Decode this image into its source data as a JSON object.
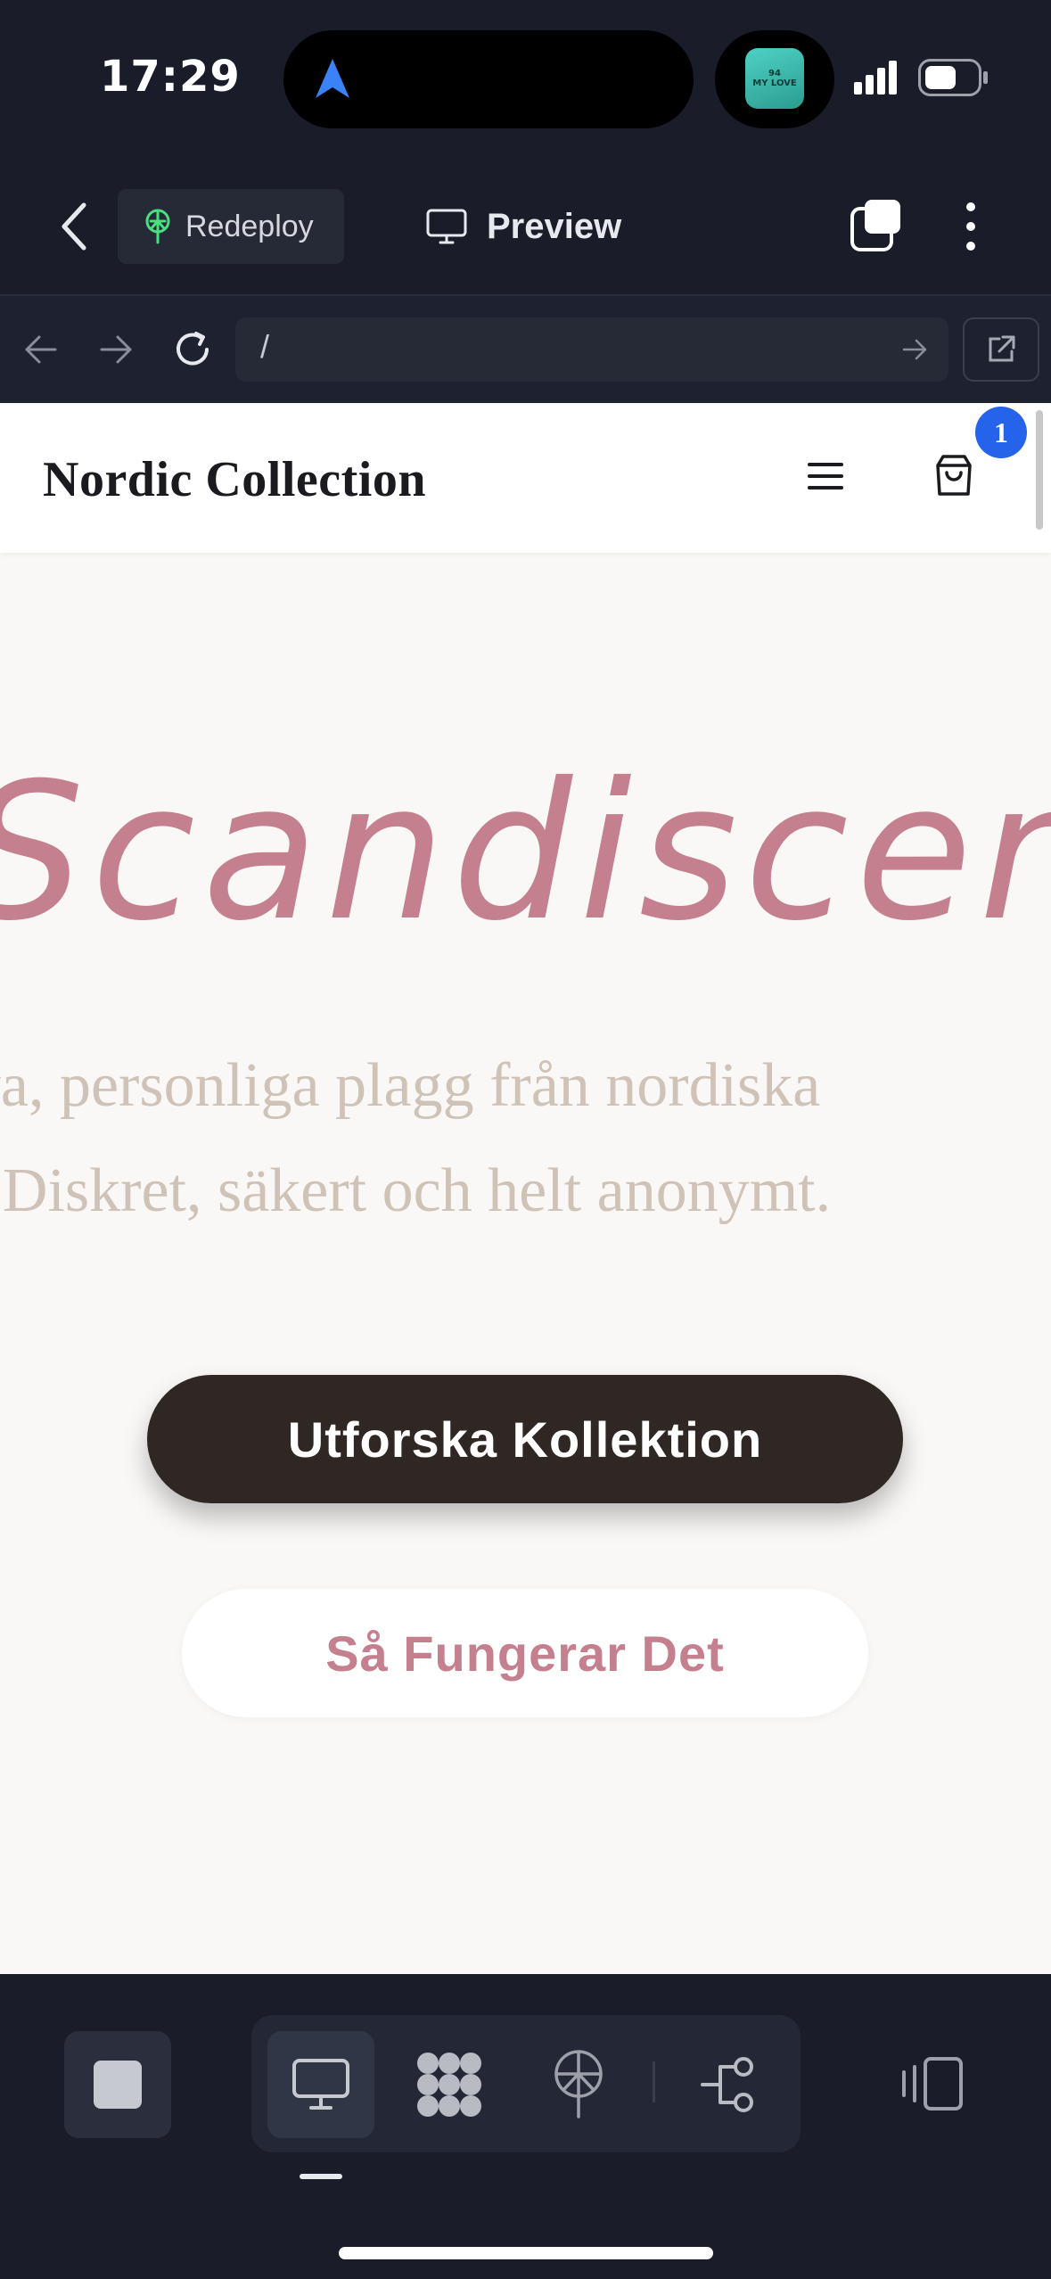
{
  "status_bar": {
    "time": "17:29",
    "location_icon": "location-arrow-icon",
    "now_playing_art_text": [
      "94",
      "MY LOVE"
    ],
    "signal_icon": "cellular-signal-icon",
    "battery_icon": "battery-icon"
  },
  "toolbar": {
    "back_icon": "chevron-left-icon",
    "redeploy_label": "Redeploy",
    "preview_label": "Preview",
    "tabs_icon": "tabs-icon",
    "more_icon": "more-vertical-icon"
  },
  "browser": {
    "url": "/",
    "back_icon": "arrow-left-icon",
    "forward_icon": "arrow-right-icon",
    "reload_icon": "reload-icon",
    "go_icon": "go-arrow-icon",
    "external_icon": "external-link-icon"
  },
  "site": {
    "brand": "Nordic Collection",
    "cart_count": "1",
    "hero_title": "Scandiscent",
    "hero_sub_line1": "Exklusiva, personliga plagg från nordiska",
    "hero_sub_line2": "kvinnor. Diskret, säkert och helt anonymt.",
    "cta_primary": "Utforska Kollektion",
    "cta_secondary": "Så Fungerar Det"
  },
  "colors": {
    "accent_pink": "#c4808f",
    "dark_button": "#2e2724",
    "badge_blue": "#2563eb",
    "app_bg": "#1a1d29"
  },
  "bottom_bar": {
    "stop_icon": "stop-icon",
    "segment_items": [
      "desktop-icon",
      "components-icon",
      "deploy-icon",
      "workflow-icon"
    ],
    "active_item": "desktop-icon",
    "panel_icon": "side-panel-icon"
  }
}
